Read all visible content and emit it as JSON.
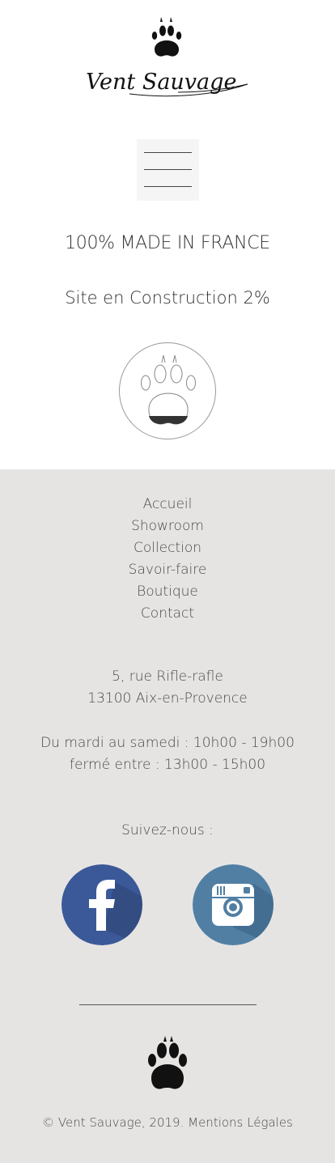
{
  "header": {
    "logo_text": "Vent Sauvage",
    "logo_icon": "paw-print-icon",
    "menu_icon": "hamburger-menu-icon"
  },
  "main": {
    "tagline": "100% MADE IN FRANCE",
    "construction": "Site en Construction 2%",
    "badge_icon": "paw-print-progress-badge",
    "progress_percent": 2
  },
  "footer": {
    "nav": [
      {
        "label": "Accueil"
      },
      {
        "label": "Showroom"
      },
      {
        "label": "Collection"
      },
      {
        "label": "Savoir-faire"
      },
      {
        "label": "Boutique"
      },
      {
        "label": "Contact"
      }
    ],
    "address_line1": "5, rue Rifle-rafle",
    "address_line2": "13100 Aix-en-Provence",
    "hours_line1": "Du mardi au samedi : 10h00 - 19h00",
    "hours_line2": "fermé entre : 13h00 - 15h00",
    "follow_label": "Suivez-nous :",
    "social": [
      {
        "icon": "facebook-icon",
        "color": "#3b5998"
      },
      {
        "icon": "instagram-icon",
        "color": "#517fa4"
      }
    ],
    "copyright": "© Vent Sauvage, 2019. Mentions Légales"
  },
  "colors": {
    "background_top": "#ffffff",
    "background_footer": "#e6e4e2",
    "text": "#4a4a4a"
  }
}
